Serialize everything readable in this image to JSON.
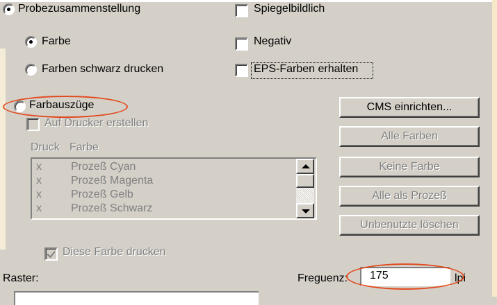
{
  "options": {
    "probe": "Probezusammenstellung",
    "farbe": "Farbe",
    "schwarz": "Farben schwarz drucken",
    "separations": "Farbauszüge",
    "on_printer": "Auf Drucker erstellen"
  },
  "checkboxes": {
    "mirror": "Spiegelbildlich",
    "negative": "Negativ",
    "eps": "EPS-Farben erhalten",
    "print_color": "Diese Farbe drucken"
  },
  "list": {
    "header_print": "Druck",
    "header_color": "Farbe",
    "rows": [
      {
        "mark": "x",
        "name": "Prozeß Cyan"
      },
      {
        "mark": "x",
        "name": "Prozeß Magenta"
      },
      {
        "mark": "x",
        "name": "Prozeß Gelb"
      },
      {
        "mark": "x",
        "name": "Prozeß Schwarz"
      }
    ]
  },
  "buttons": {
    "cms": "CMS einrichten...",
    "all_colors": "Alle Farben",
    "no_color": "Keine Farbe",
    "all_process": "Alle als Prozeß",
    "delete_unused": "Unbenutzte löschen"
  },
  "raster": {
    "label": "Raster:",
    "freq_label": "Freguenz:",
    "freq_value": "175",
    "unit": "lpi"
  },
  "colors": {
    "dialog_bg": "#d4d0c8",
    "annotation": "#e24a1f"
  }
}
